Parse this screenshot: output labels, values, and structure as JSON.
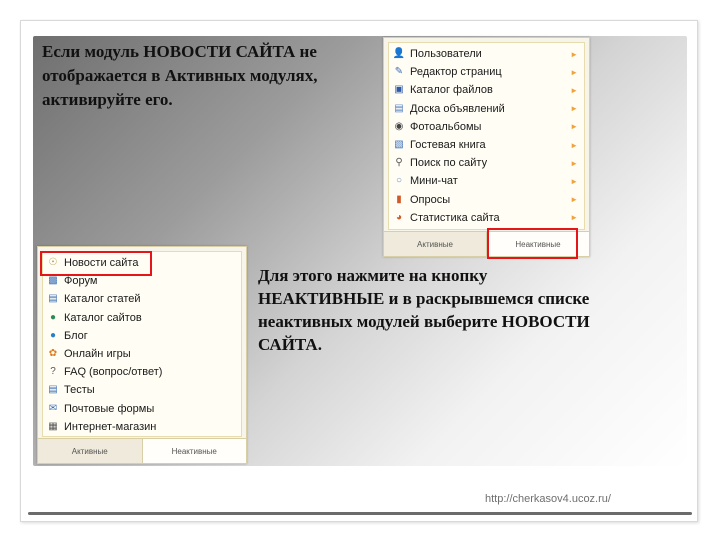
{
  "slide": {
    "text1": [
      "Если модуль НОВОСТИ САЙТА не",
      "отображается в Активных модулях,",
      "активируйте его."
    ],
    "text2": [
      "Для этого нажмите на кнопку",
      "НЕАКТИВНЫЕ и в раскрывшемся списке",
      "неактивных модулей выберите НОВОСТИ",
      "САЙТА."
    ],
    "url": "http://cherkasov4.ucoz.ru/"
  },
  "active_panel": {
    "items": [
      {
        "label": "Пользователи",
        "icon": "user-icon"
      },
      {
        "label": "Редактор страниц",
        "icon": "page-edit-icon"
      },
      {
        "label": "Каталог файлов",
        "icon": "save-icon"
      },
      {
        "label": "Доска объявлений",
        "icon": "board-icon"
      },
      {
        "label": "Фотоальбомы",
        "icon": "camera-icon"
      },
      {
        "label": "Гостевая книга",
        "icon": "book-icon"
      },
      {
        "label": "Поиск по сайту",
        "icon": "search-icon"
      },
      {
        "label": "Мини-чат",
        "icon": "chat-icon"
      },
      {
        "label": "Опросы",
        "icon": "poll-chart-icon"
      },
      {
        "label": "Статистика сайта",
        "icon": "pie-chart-icon"
      }
    ],
    "tab_active": "Активные",
    "tab_inactive": "Неактивные"
  },
  "inactive_panel": {
    "items": [
      {
        "label": "Новости сайта",
        "icon": "lightbulb-icon"
      },
      {
        "label": "Форум",
        "icon": "forum-icon"
      },
      {
        "label": "Каталог статей",
        "icon": "articles-icon"
      },
      {
        "label": "Каталог сайтов",
        "icon": "globe-icon"
      },
      {
        "label": "Блог",
        "icon": "blog-icon"
      },
      {
        "label": "Онлайн игры",
        "icon": "games-icon"
      },
      {
        "label": "FAQ (вопрос/ответ)",
        "icon": "faq-icon"
      },
      {
        "label": "Тесты",
        "icon": "tests-icon"
      },
      {
        "label": "Почтовые формы",
        "icon": "mail-form-icon"
      },
      {
        "label": "Интернет-магазин",
        "icon": "shop-icon"
      }
    ],
    "tab_active": "Активные",
    "tab_inactive": "Неактивные"
  },
  "colors": {
    "highlight": "#e4161a",
    "arrow": "#f0a23c"
  }
}
